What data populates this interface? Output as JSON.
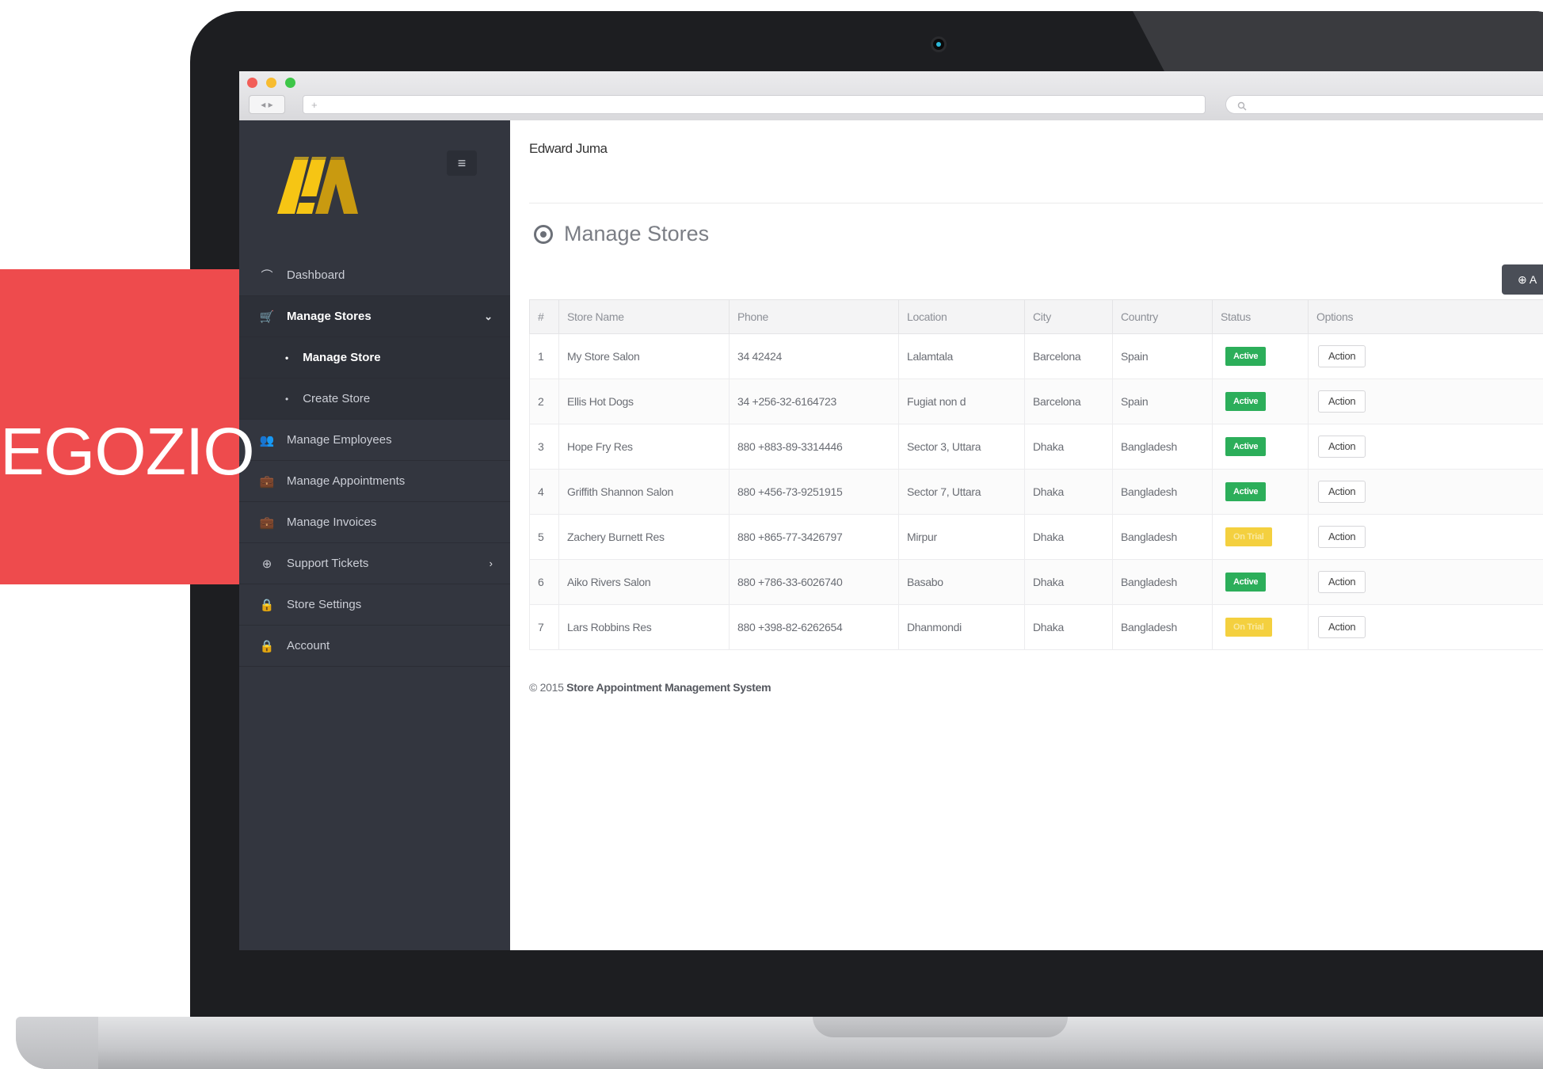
{
  "banner": {
    "text": "EGOZIO",
    "color": "#ee4b4d"
  },
  "browser": {
    "nav_buttons": "◂ ▸",
    "address": "+",
    "search_icon": "search-icon"
  },
  "sidebar": {
    "toggle_icon": "≡",
    "items": [
      {
        "label": "Dashboard",
        "icon": "⌒"
      },
      {
        "label": "Manage Stores",
        "icon": "🛒",
        "caret": "⌄"
      },
      {
        "label": "Manage Store",
        "bullet": "•"
      },
      {
        "label": "Create Store",
        "bullet": "•"
      },
      {
        "label": "Manage Employees",
        "icon": "👥"
      },
      {
        "label": "Manage Appointments",
        "icon": "💼"
      },
      {
        "label": "Manage Invoices",
        "icon": "💼"
      },
      {
        "label": "Support Tickets",
        "icon": "⊕",
        "caret": "›"
      },
      {
        "label": "Store Settings",
        "icon": "🔒"
      },
      {
        "label": "Account",
        "icon": "🔒"
      }
    ]
  },
  "header": {
    "user_name": "Edward Juma"
  },
  "page": {
    "title": "Manage Stores",
    "add_button": "⊕ A"
  },
  "table": {
    "headers": [
      "#",
      "Store Name",
      "Phone",
      "Location",
      "City",
      "Country",
      "Status",
      "Options"
    ],
    "rows": [
      {
        "num": "1",
        "name": "My Store Salon",
        "phone": "34 42424",
        "location": "Lalamtala",
        "city": "Barcelona",
        "country": "Spain",
        "status": "Active",
        "status_type": "active",
        "option": "Action"
      },
      {
        "num": "2",
        "name": "Ellis Hot Dogs",
        "phone": "34 +256-32-6164723",
        "location": "Fugiat non d",
        "city": "Barcelona",
        "country": "Spain",
        "status": "Active",
        "status_type": "active",
        "option": "Action"
      },
      {
        "num": "3",
        "name": "Hope Fry Res",
        "phone": "880 +883-89-3314446",
        "location": "Sector 3, Uttara",
        "city": "Dhaka",
        "country": "Bangladesh",
        "status": "Active",
        "status_type": "active",
        "option": "Action"
      },
      {
        "num": "4",
        "name": "Griffith Shannon Salon",
        "phone": "880 +456-73-9251915",
        "location": "Sector 7, Uttara",
        "city": "Dhaka",
        "country": "Bangladesh",
        "status": "Active",
        "status_type": "active",
        "option": "Action"
      },
      {
        "num": "5",
        "name": "Zachery Burnett Res",
        "phone": "880 +865-77-3426797",
        "location": "Mirpur",
        "city": "Dhaka",
        "country": "Bangladesh",
        "status": "On Trial",
        "status_type": "ontrial",
        "option": "Action"
      },
      {
        "num": "6",
        "name": "Aiko Rivers Salon",
        "phone": "880 +786-33-6026740",
        "location": "Basabo",
        "city": "Dhaka",
        "country": "Bangladesh",
        "status": "Active",
        "status_type": "active",
        "option": "Action"
      },
      {
        "num": "7",
        "name": "Lars Robbins Res",
        "phone": "880 +398-82-6262654",
        "location": "Dhanmondi",
        "city": "Dhaka",
        "country": "Bangladesh",
        "status": "On Trial",
        "status_type": "ontrial",
        "option": "Action"
      }
    ]
  },
  "footer": {
    "copyright": "© 2015",
    "system_name": "Store Appointment Management System"
  },
  "colors": {
    "sidebar": "#33363f",
    "active_badge": "#2cae5a",
    "trial_badge": "#f4d03f",
    "accent": "#ee4b4d"
  }
}
